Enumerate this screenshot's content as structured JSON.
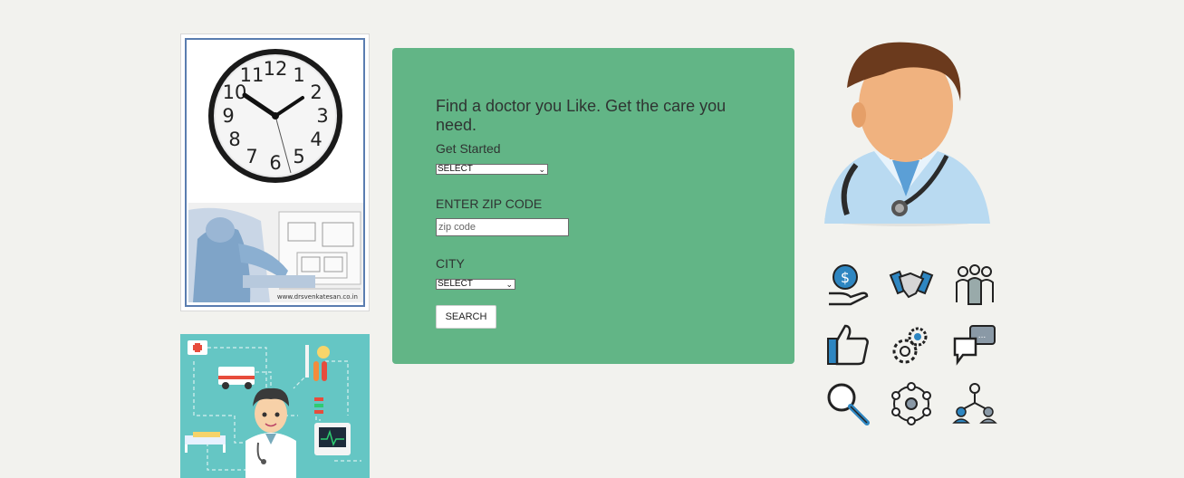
{
  "clock_card": {
    "clock_numbers": [
      "12",
      "1",
      "2",
      "3",
      "4",
      "5",
      "6",
      "7",
      "8",
      "9",
      "10",
      "11"
    ],
    "watermark": "www.drsvenkatesan.co.in"
  },
  "search_form": {
    "title": "Find a doctor you Like. Get the care you need.",
    "get_started_label": "Get Started",
    "specialty_select_value": "SELECT",
    "zip_label": "ENTER ZIP CODE",
    "zip_placeholder": "zip code",
    "city_label": "CITY",
    "city_select_value": "SELECT",
    "search_button": "SEARCH"
  },
  "colors": {
    "page_bg": "#f2f2ee",
    "panel_bg": "#62b586",
    "health_bg": "#65c6c4",
    "icon_blue": "#2e86c1"
  },
  "feature_icons": [
    "money-hand-icon",
    "handshake-icon",
    "team-icon",
    "thumbs-up-icon",
    "gears-icon",
    "chat-icon",
    "magnifier-icon",
    "network-icon",
    "hierarchy-icon"
  ]
}
